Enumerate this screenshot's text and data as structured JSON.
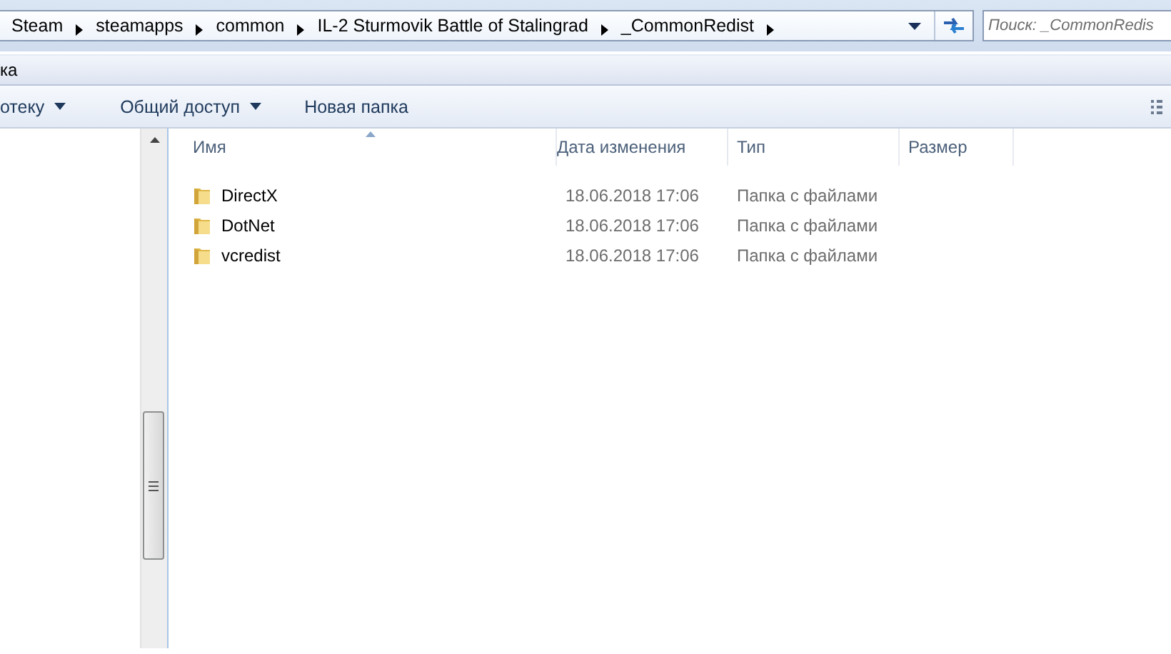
{
  "address_bar": {
    "breadcrumbs": [
      "Steam",
      "steamapps",
      "common",
      "IL-2 Sturmovik Battle of Stalingrad",
      "_CommonRedist"
    ]
  },
  "search": {
    "placeholder": "Поиск: _CommonRedis"
  },
  "menu_bar": {
    "text": "ка"
  },
  "toolbar": {
    "buttons": [
      {
        "label": "отеку",
        "dropdown": true
      },
      {
        "label": "Общий доступ",
        "dropdown": true
      },
      {
        "label": "Новая папка",
        "dropdown": false
      }
    ]
  },
  "file_list": {
    "columns": [
      {
        "label": "Имя",
        "sorted": true
      },
      {
        "label": "Дата изменения",
        "sorted": false
      },
      {
        "label": "Тип",
        "sorted": false
      },
      {
        "label": "Размер",
        "sorted": false
      }
    ],
    "rows": [
      {
        "name": "DirectX",
        "modified": "18.06.2018 17:06",
        "type": "Папка с файлами"
      },
      {
        "name": "DotNet",
        "modified": "18.06.2018 17:06",
        "type": "Папка с файлами"
      },
      {
        "name": "vcredist",
        "modified": "18.06.2018 17:06",
        "type": "Папка с файлами"
      }
    ]
  }
}
